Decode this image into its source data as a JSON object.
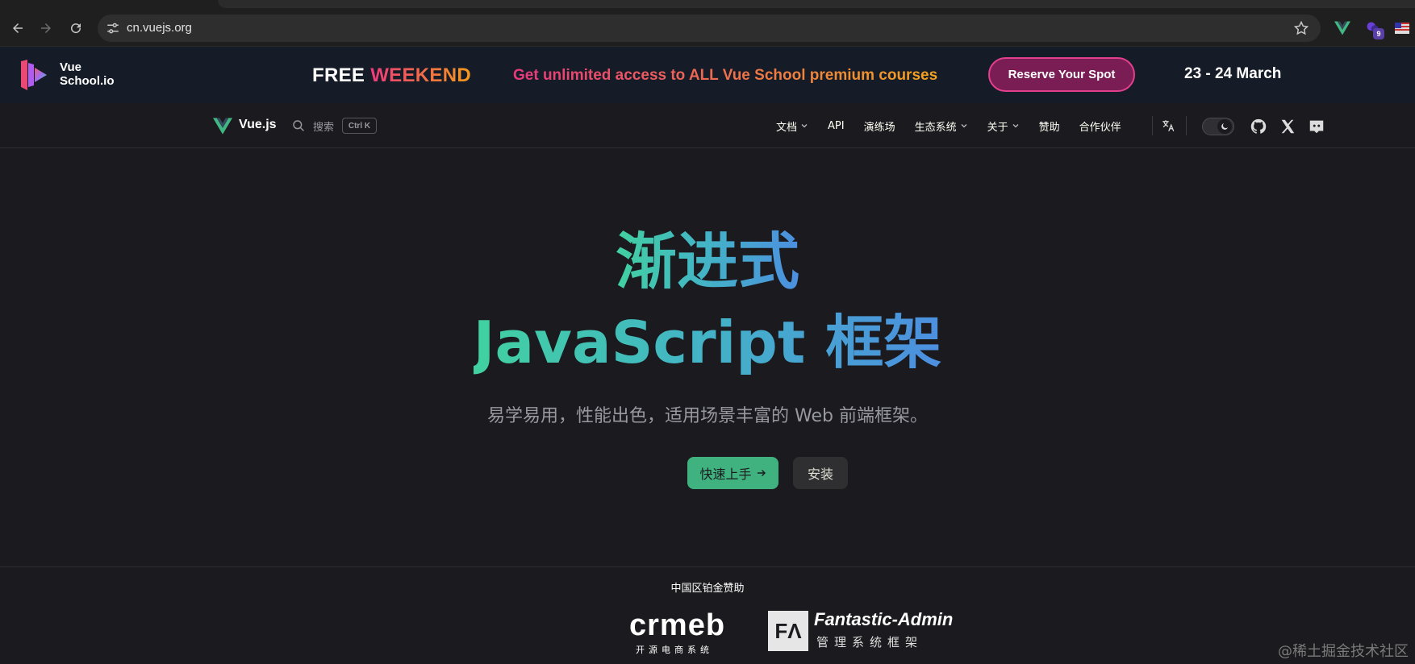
{
  "browser": {
    "url": "cn.vuejs.org",
    "extension_badge": "9"
  },
  "banner": {
    "brand_line1": "Vue",
    "brand_line2": "School.io",
    "free": "FREE",
    "weekend": "WEEKEND",
    "promo": "Get unlimited access to ALL Vue School premium courses",
    "cta": "Reserve Your Spot",
    "dates": "23 - 24 March"
  },
  "navbar": {
    "title": "Vue.js",
    "search_label": "搜索",
    "search_kbd": "Ctrl K",
    "links": [
      "文档",
      "API",
      "演练场",
      "生态系统",
      "关于",
      "赞助",
      "合作伙伴"
    ]
  },
  "hero": {
    "line1": "渐进式",
    "line2": "JavaScript 框架",
    "tagline": "易学易用，性能出色，适用场景丰富的 Web 前端框架。",
    "primary_button": "快速上手",
    "secondary_button": "安装"
  },
  "sponsors": {
    "title": "中国区铂金赞助",
    "crmeb_name": "crmeb",
    "crmeb_sub": "开源电商系统",
    "fa_name": "Fantastic-Admin",
    "fa_sub": "管理系统框架"
  },
  "watermark": "@稀土掘金技术社区",
  "colors": {
    "vue_green": "#42b883",
    "banner_bg": "#151c28",
    "page_bg": "#1b1b1f",
    "accent_pink": "#e23f8c"
  }
}
